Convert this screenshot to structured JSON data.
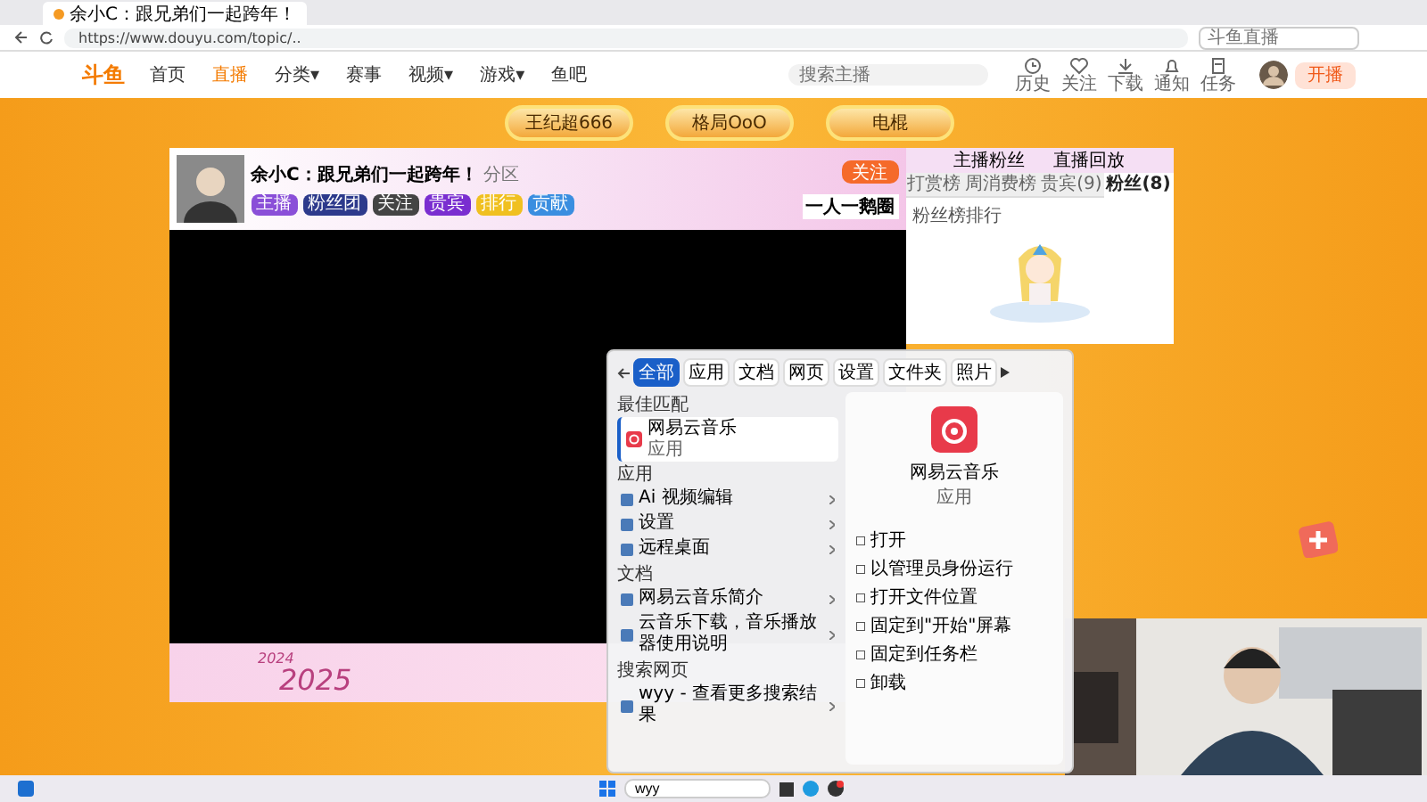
{
  "browser": {
    "tab_title": "余小C：跟兄弟们一起跨年！",
    "address": "https://www.douyu.com/topic/..",
    "search_placeholder": "斗鱼直播"
  },
  "header": {
    "logo": "斗鱼",
    "nav": [
      {
        "label": "首页",
        "selected": false
      },
      {
        "label": "直播",
        "selected": true
      },
      {
        "label": "分类▾",
        "selected": false
      },
      {
        "label": "赛事",
        "selected": false
      },
      {
        "label": "视频▾",
        "selected": false
      },
      {
        "label": "游戏▾",
        "selected": false
      },
      {
        "label": "鱼吧",
        "selected": false
      }
    ],
    "search_placeholder": "搜索主播",
    "icons": [
      {
        "kind": "clock",
        "label": "历史"
      },
      {
        "kind": "heart",
        "label": "关注"
      },
      {
        "kind": "download",
        "label": "下载"
      },
      {
        "kind": "bell",
        "label": "通知"
      },
      {
        "kind": "task",
        "label": "任务"
      }
    ],
    "live_button": "开播"
  },
  "room_buttons": [
    "王纪超666",
    "格局OoO",
    "电棍"
  ],
  "stream": {
    "streamer_title": "余小C：跟兄弟们一起跨年！",
    "category": "分区",
    "tags": [
      "主播",
      "粉丝团",
      "关注",
      "贵宾",
      "排行",
      "贡献"
    ],
    "follow": "关注",
    "banner_text": "一人一鹅圈",
    "banner_years": [
      "2024",
      "2025"
    ]
  },
  "side_panel": {
    "links": [
      "主播粉丝",
      "直播回放"
    ],
    "tabs": [
      {
        "label": "打赏榜",
        "selected": false
      },
      {
        "label": "周消费榜",
        "selected": false
      },
      {
        "label": "贵宾(9)",
        "selected": false
      },
      {
        "label": "粉丝(8)",
        "selected": true
      }
    ],
    "note": "粉丝榜排行"
  },
  "search_popup": {
    "filters": [
      {
        "label": "全部",
        "selected": true
      },
      {
        "label": "应用",
        "selected": false
      },
      {
        "label": "文档",
        "selected": false
      },
      {
        "label": "网页",
        "selected": false
      },
      {
        "label": "设置",
        "selected": false
      },
      {
        "label": "文件夹",
        "selected": false
      },
      {
        "label": "照片",
        "selected": false
      }
    ],
    "best_heading": "最佳匹配",
    "best": {
      "name": "网易云音乐",
      "type": "应用"
    },
    "sections": [
      {
        "heading": "应用",
        "items": [
          "Ai 视频编辑",
          "设置",
          "远程桌面"
        ]
      },
      {
        "heading": "文档",
        "items": [
          "网易云音乐简介",
          "云音乐下载，音乐播放器使用说明"
        ]
      },
      {
        "heading": "搜索网页",
        "items": [
          "wyy - 查看更多搜索结果"
        ]
      }
    ],
    "detail": {
      "name": "网易云音乐",
      "type": "应用",
      "actions": [
        "打开",
        "以管理员身份运行",
        "打开文件位置",
        "固定到\"开始\"屏幕",
        "固定到任务栏",
        "卸载"
      ]
    }
  },
  "taskbar": {
    "search_value": "wyy"
  }
}
